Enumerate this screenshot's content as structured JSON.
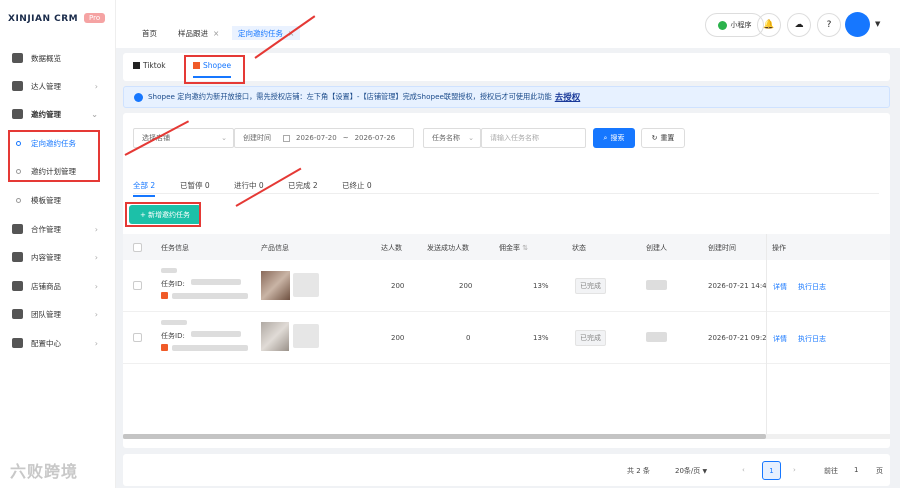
{
  "brand": {
    "logo": "XINJIAN CRM",
    "badge": "Pro"
  },
  "sidebar": {
    "items": [
      {
        "label": "数据概览"
      },
      {
        "label": "达人管理"
      },
      {
        "label": "邀约管理"
      },
      {
        "label": "定向邀约任务"
      },
      {
        "label": "邀约计划管理"
      },
      {
        "label": "模板管理"
      },
      {
        "label": "合作管理"
      },
      {
        "label": "内容管理"
      },
      {
        "label": "店铺商品"
      },
      {
        "label": "团队管理"
      },
      {
        "label": "配置中心"
      }
    ]
  },
  "watermark": "六败跨境",
  "tabs": [
    {
      "label": "首页"
    },
    {
      "label": "样品跟进",
      "close": "×"
    },
    {
      "label": "定向邀约任务",
      "close": "×"
    }
  ],
  "header": {
    "mini_program": "小程序"
  },
  "platforms": [
    {
      "label": "Tiktok"
    },
    {
      "label": "Shopee"
    }
  ],
  "notice": {
    "text": "Shopee 定向邀约为新开放接口，需先授权店铺：左下角【设置】-【店铺管理】完成Shopee联盟授权，授权后才可使用此功能",
    "link": "去授权"
  },
  "filters": {
    "store_placeholder": "选择店铺",
    "date_label": "创建时间",
    "date_start": "2026-07-20",
    "date_sep": "~",
    "date_end": "2026-07-26",
    "name_select": "任务名称",
    "name_placeholder": "请输入任务名称",
    "search": "搜索",
    "reset": "重置"
  },
  "status_tabs": [
    {
      "label": "全部 2"
    },
    {
      "label": "已暂停 0"
    },
    {
      "label": "进行中 0"
    },
    {
      "label": "已完成 2"
    },
    {
      "label": "已终止 0"
    }
  ],
  "add_button": "+ 新增邀约任务",
  "table": {
    "columns": [
      "任务信息",
      "产品信息",
      "达人数",
      "发送成功人数",
      "佣金率",
      "状态",
      "创建人",
      "创建时间",
      "操作"
    ],
    "rows": [
      {
        "task_id_label": "任务ID:",
        "creators": "200",
        "sent": "200",
        "commission": "13%",
        "status": "已完成",
        "created": "2026-07-21 14:4",
        "action1": "详情",
        "action2": "执行日志"
      },
      {
        "task_id_label": "任务ID:",
        "creators": "200",
        "sent": "0",
        "commission": "13%",
        "status": "已完成",
        "created": "2026-07-21 09:2",
        "action1": "详情",
        "action2": "执行日志"
      }
    ]
  },
  "pagination": {
    "total": "共 2 条",
    "page_size": "20条/页",
    "prev": "‹",
    "current": "1",
    "next": "›",
    "goto_label": "前往",
    "goto_value": "1",
    "page_unit": "页"
  },
  "colors": {
    "accent": "#1677ff",
    "add_button": "#1cc0a8",
    "annotation": "#e53935"
  }
}
